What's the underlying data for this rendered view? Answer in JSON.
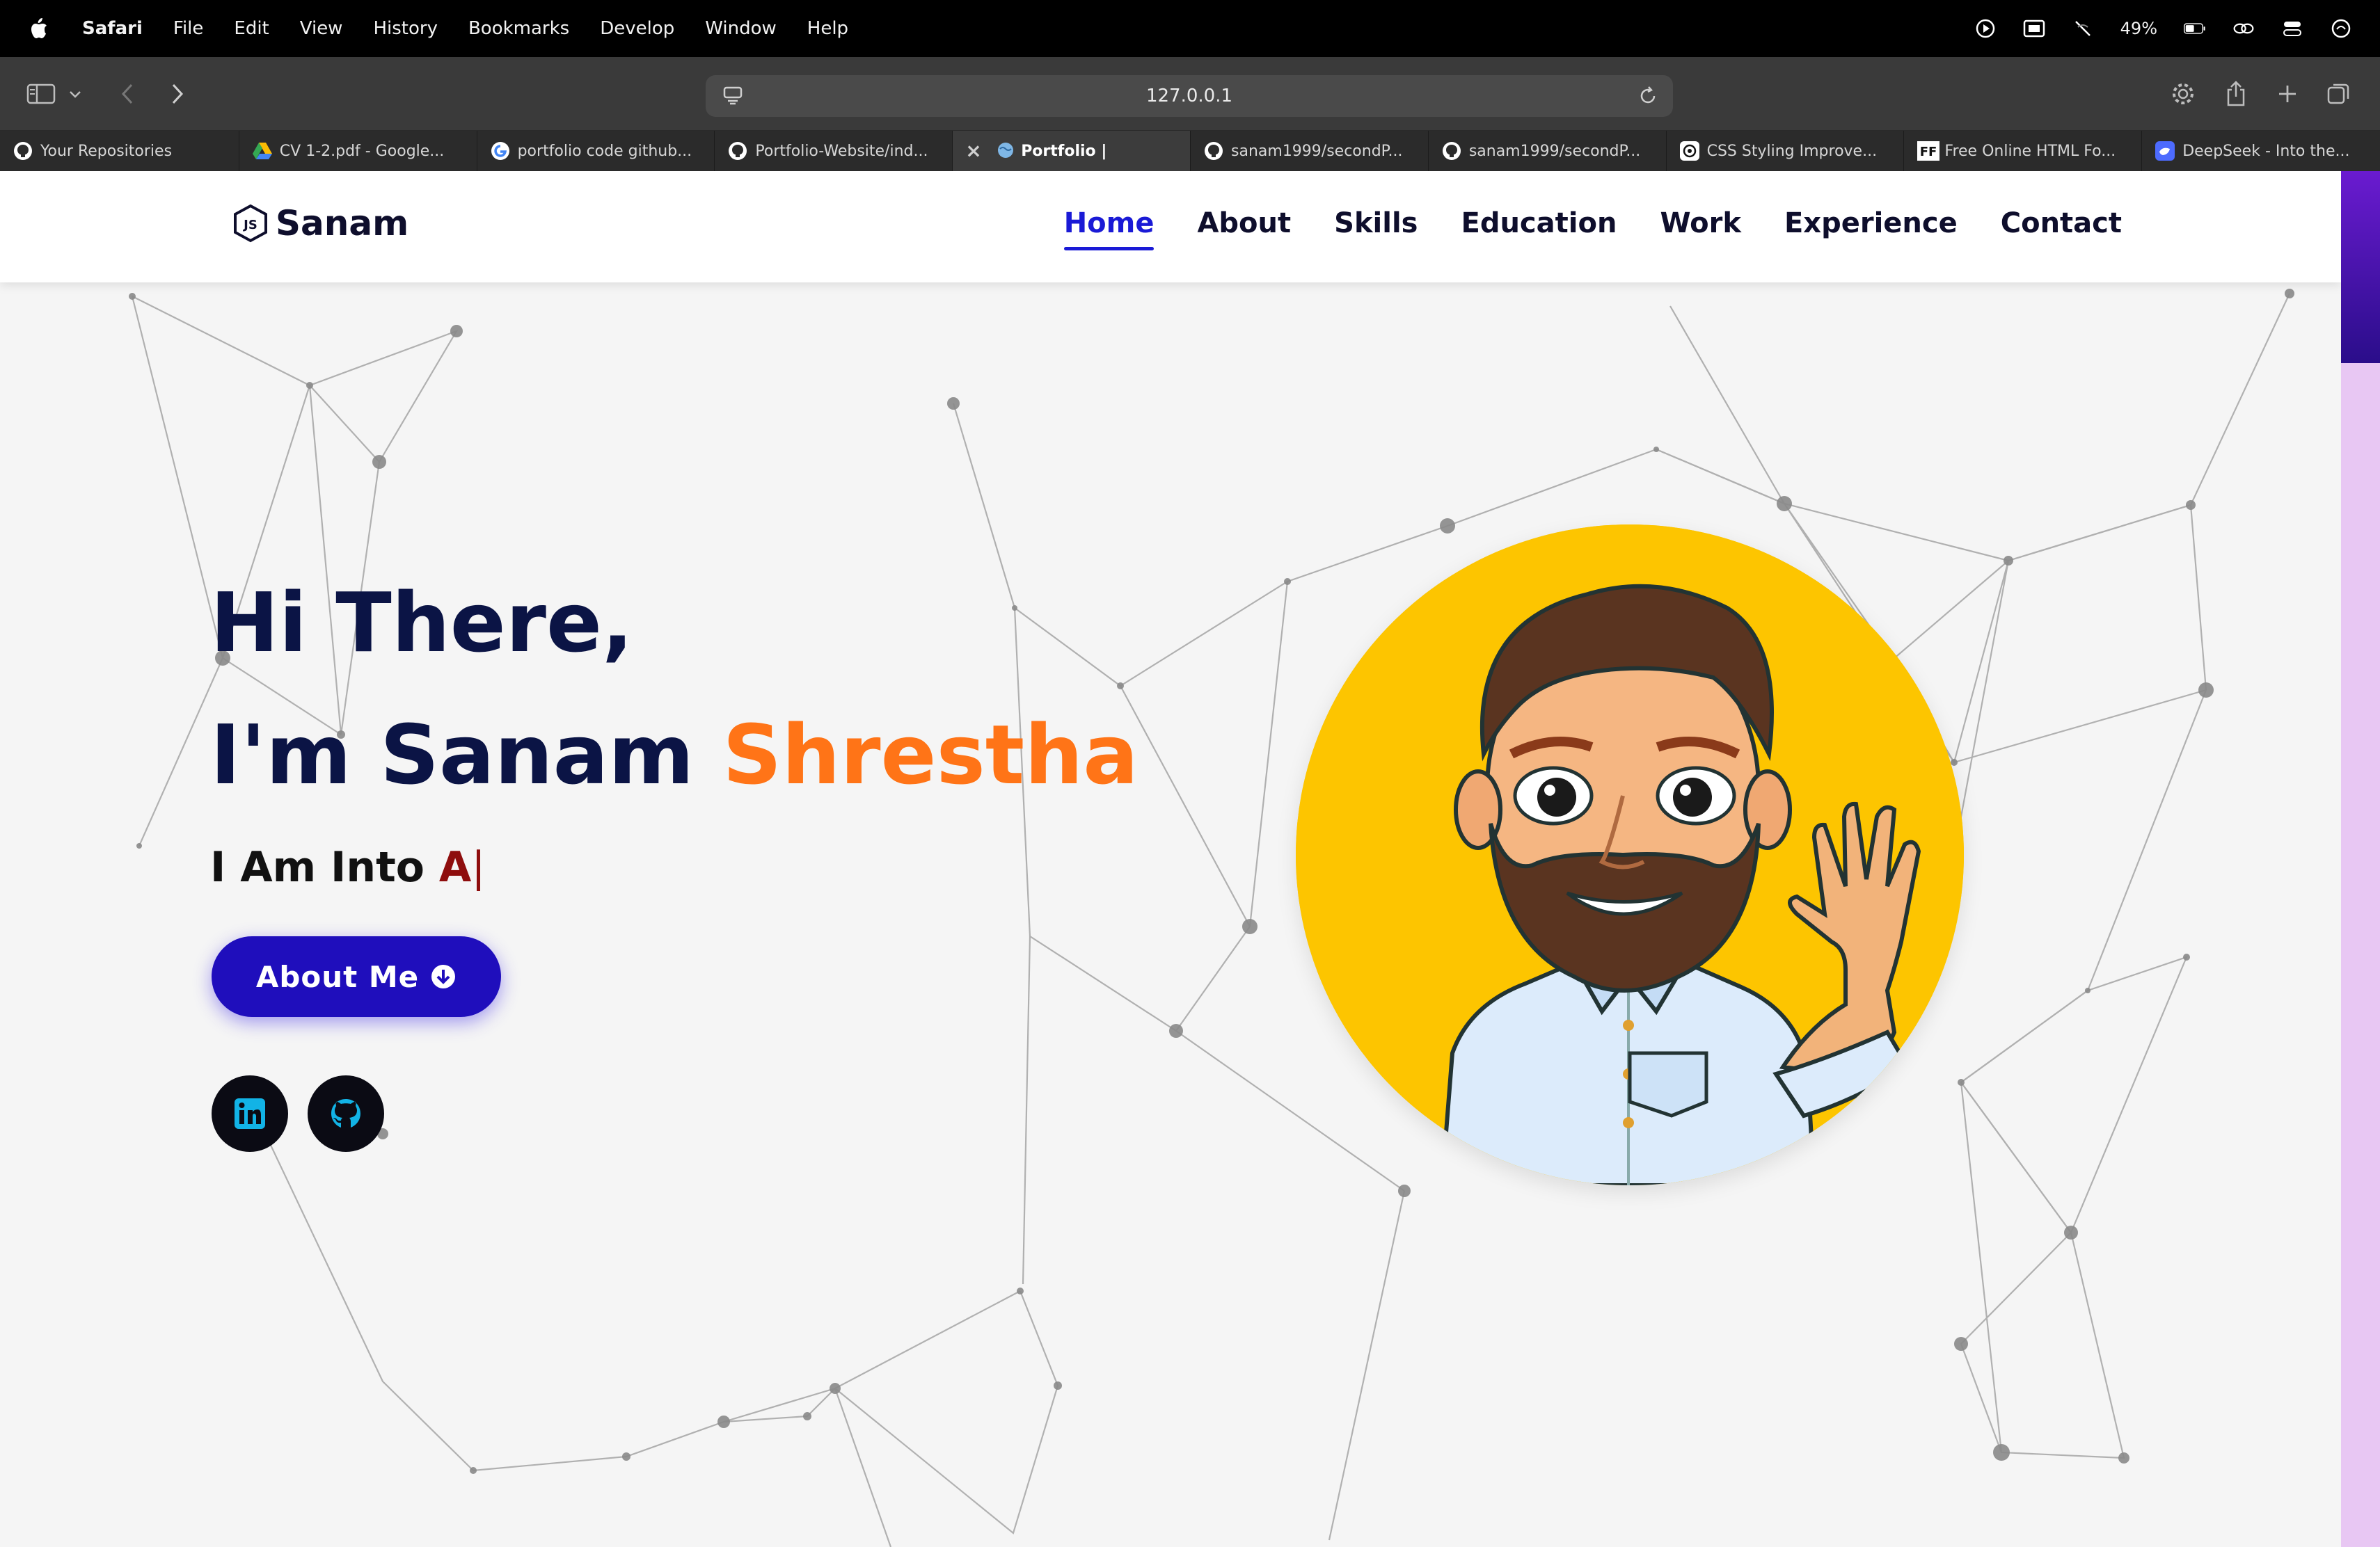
{
  "menubar": {
    "app": "Safari",
    "items": [
      "File",
      "Edit",
      "View",
      "History",
      "Bookmarks",
      "Develop",
      "Window",
      "Help"
    ],
    "battery": "49%"
  },
  "toolbar": {
    "url": "127.0.0.1"
  },
  "tabs": [
    {
      "label": "Your Repositories",
      "icon": "github-icon"
    },
    {
      "label": "CV 1-2.pdf - Google...",
      "icon": "google-drive-icon"
    },
    {
      "label": "portfolio code github...",
      "icon": "google-icon"
    },
    {
      "label": "Portfolio-Website/ind...",
      "icon": "github-icon"
    },
    {
      "label": "Portfolio |",
      "icon": "globe-icon",
      "active": true
    },
    {
      "label": "sanam1999/secondP...",
      "icon": "github-icon"
    },
    {
      "label": "sanam1999/secondP...",
      "icon": "github-icon"
    },
    {
      "label": "CSS Styling Improve...",
      "icon": "openai-icon"
    },
    {
      "label": "Free Online HTML Fo...",
      "icon": "ff-icon"
    },
    {
      "label": "DeepSeek - Into the...",
      "icon": "deepseek-icon"
    }
  ],
  "site": {
    "logo_text": "Sanam",
    "nav": [
      "Home",
      "About",
      "Skills",
      "Education",
      "Work",
      "Experience",
      "Contact"
    ],
    "active_nav": "Home",
    "hero": {
      "line1": "Hi There,",
      "line2_prefix": "I'm Sanam ",
      "line2_accent": "Shrestha",
      "typing_prefix": "I Am Into ",
      "typing_value": "A",
      "caret": "|",
      "button_label": "About Me"
    },
    "social": [
      "linkedin-icon",
      "github-icon"
    ]
  },
  "colors": {
    "accent_orange": "#ff7417",
    "nav_active": "#1a1ad6",
    "button": "#1f0ebc",
    "title": "#0b1445",
    "avatar_bg": "#fdc500"
  }
}
